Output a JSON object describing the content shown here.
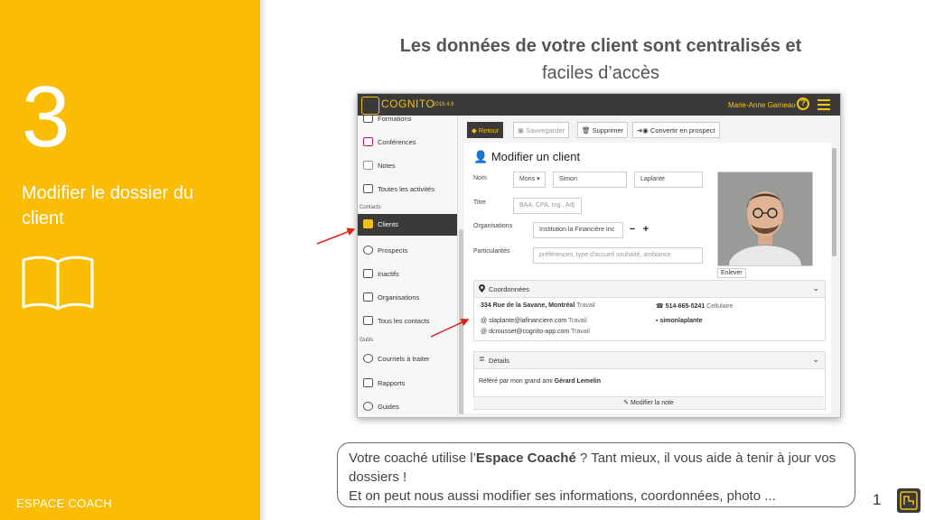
{
  "slide": {
    "step_number": "3",
    "step_title": "Modifier le dossier du client",
    "footer_brand": "ESPACE COACH",
    "title_bold": "Les données de votre client sont centralisés et",
    "title_line2": "faciles d’accès",
    "page_number": "1",
    "callout_prefix": "Votre coaché utilise l’",
    "callout_bold": "Espace Coaché",
    "callout_suffix": " ? Tant mieux, il vous aide à tenir à jour vos dossiers !",
    "callout_line3": "Et on peut nous aussi modifier ses informations, coordonnées, photo ...",
    "accent_color": "#fbbc04"
  },
  "app": {
    "name": "COGNITO",
    "version": "2018.4.9",
    "user_name": "Marie-Anne Garneau",
    "help_label": "?",
    "sidebar": {
      "items": [
        {
          "label": "Formations",
          "icon": "graduation-icon"
        },
        {
          "label": "Conférences",
          "icon": "megaphone-icon"
        },
        {
          "label": "Notes",
          "icon": "note-icon"
        },
        {
          "label": "Toutes les activités",
          "icon": "list-icon"
        },
        {
          "label": "Clients",
          "icon": "user-icon"
        },
        {
          "label": "Prospects",
          "icon": "target-icon"
        },
        {
          "label": "Inactifs",
          "icon": "inactive-user-icon"
        },
        {
          "label": "Organisations",
          "icon": "organization-icon"
        },
        {
          "label": "Tous les contacts",
          "icon": "contacts-icon"
        },
        {
          "label": "Courriels à traiter",
          "icon": "email-icon"
        },
        {
          "label": "Rapports",
          "icon": "report-icon"
        },
        {
          "label": "Guides",
          "icon": "guide-icon"
        }
      ],
      "section_contacts": "Contacts",
      "section_outils": "Outils"
    },
    "toolbar": {
      "back": "Retour",
      "save": "Sauvegarder",
      "delete": "Supprimer",
      "convert": "Convertir en prospect"
    },
    "form": {
      "title": "Modifier un client",
      "nom_label": "Nom",
      "salutation_value": "Mons",
      "first_name": "Simon",
      "last_name": "Laplante",
      "titre_label": "Titre",
      "titre_placeholder": "BAA, CPA, Ing., Adj",
      "organisations_label": "Organisations",
      "organisation_value": "Institution la Financière Inc",
      "minus": "−",
      "plus": "+",
      "particularites_label": "Particularités",
      "particularites_placeholder": "préférences, type d'accueil souhaité, ambiance",
      "photo_remove": "Enlever"
    },
    "coordonnees": {
      "title": "Coordonnées",
      "address": "334 Rue de la Savane, Montréal",
      "address_type": "Travail",
      "phone": "514-665-5241",
      "phone_type": "Cellulaire",
      "email1": "slaplante@lafinanciere.com",
      "email1_type": "Travail",
      "email2": "dcrousset@cognito-app.com",
      "email2_type": "Travail",
      "linkedin": "simonlaplante"
    },
    "details": {
      "title": "Détails",
      "text_prefix": "Référé par mon grand ami ",
      "text_bold": "Gérard Lemelin",
      "edit_note": "Modifier la note"
    }
  }
}
